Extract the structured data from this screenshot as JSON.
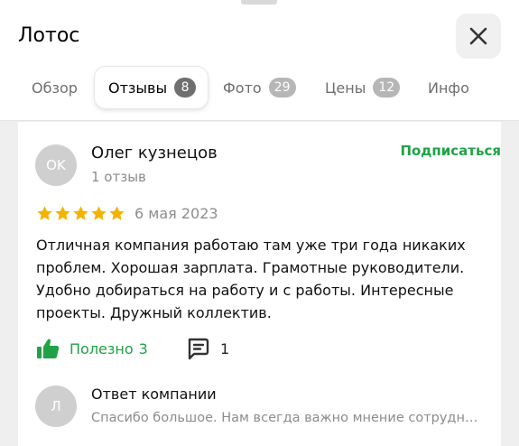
{
  "header": {
    "title": "Лотос",
    "close_icon": "close-icon",
    "tabs": [
      {
        "label": "Обзор",
        "badge": null,
        "active": false
      },
      {
        "label": "Отзывы",
        "badge": "8",
        "active": true
      },
      {
        "label": "Фото",
        "badge": "29",
        "active": false
      },
      {
        "label": "Цены",
        "badge": "12",
        "active": false
      },
      {
        "label": "Инфо",
        "badge": null,
        "active": false
      }
    ]
  },
  "review": {
    "author": {
      "initials": "OK",
      "name": "Олег кузнецов",
      "reviews_count": "1 отзыв"
    },
    "subscribe_label": "Подписаться",
    "rating": 5,
    "rating_max": 5,
    "date": "6 мая 2023",
    "text": "Отличная компания работаю там уже три года никаких проблем. Хорошая зарплата. Грамотные руководители. Удобно добираться на работу и с работы. Интересные проекты. Дружный коллектив.",
    "useful_label": "Полезно",
    "useful_count": "3",
    "comments_count": "1"
  },
  "reply": {
    "initials": "Л",
    "title": "Ответ компании",
    "text": "Спасибо большое. Нам всегда важно мнение сотрудников…"
  },
  "colors": {
    "accent_green": "#1fa246",
    "star": "#f3b300",
    "badge_active": "#6f6f6f",
    "badge_inactive": "#b6b6b6",
    "avatar": "#cfcfcf"
  }
}
